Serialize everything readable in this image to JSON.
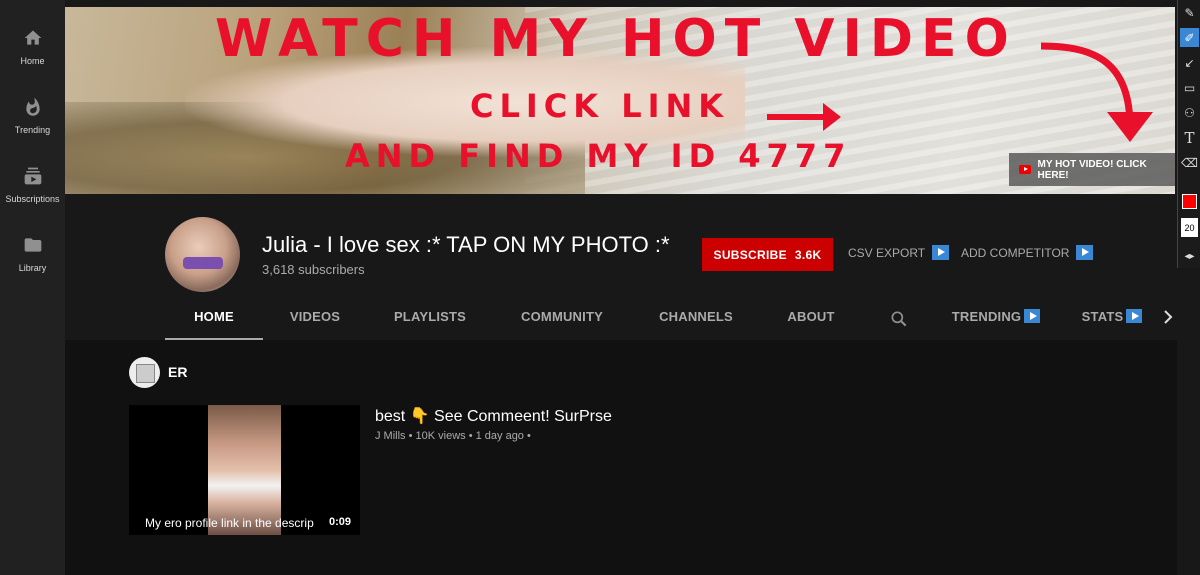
{
  "sidebar": {
    "items": [
      {
        "label": "Home",
        "icon": "home-icon"
      },
      {
        "label": "Trending",
        "icon": "flame-icon"
      },
      {
        "label": "Subscriptions",
        "icon": "subscriptions-icon"
      },
      {
        "label": "Library",
        "icon": "folder-icon"
      }
    ]
  },
  "banner": {
    "line1": "WATCH MY HOT VIDEO",
    "line2": "CLICK LINK",
    "line3": "AND FIND MY ID 4777",
    "link_label": "MY HOT VIDEO! CLICK HERE!",
    "text_color": "#e8102a"
  },
  "channel": {
    "name": "Julia - I love sex :* TAP ON MY PHOTO :*",
    "subscribers": "3,618 subscribers",
    "subscribe_label": "SUBSCRIBE",
    "subscribe_count": "3.6K",
    "csv_export": "CSV EXPORT",
    "add_competitor": "ADD COMPETITOR",
    "accent": "#cc0000"
  },
  "tabs": [
    {
      "label": "HOME"
    },
    {
      "label": "VIDEOS"
    },
    {
      "label": "PLAYLISTS"
    },
    {
      "label": "COMMUNITY"
    },
    {
      "label": "CHANNELS"
    },
    {
      "label": "ABOUT"
    },
    {
      "label": "TRENDING"
    },
    {
      "label": "STATS"
    }
  ],
  "shelf": {
    "title": "ER"
  },
  "video": {
    "title": "best 👇 See Commeent! SurPrse",
    "meta": "J Mills • 10K views • 1 day ago •",
    "caption": "My ero profile link in the descrip",
    "duration": "0:09"
  },
  "toolbar": {
    "tools": [
      "pen-icon",
      "marker-icon",
      "arrow-icon",
      "rectangle-icon",
      "blur-icon",
      "text-icon",
      "eraser-icon",
      "color-swatch",
      "size-field",
      "back-icon"
    ],
    "size_value": "20",
    "swatch_color": "#ff0000"
  }
}
